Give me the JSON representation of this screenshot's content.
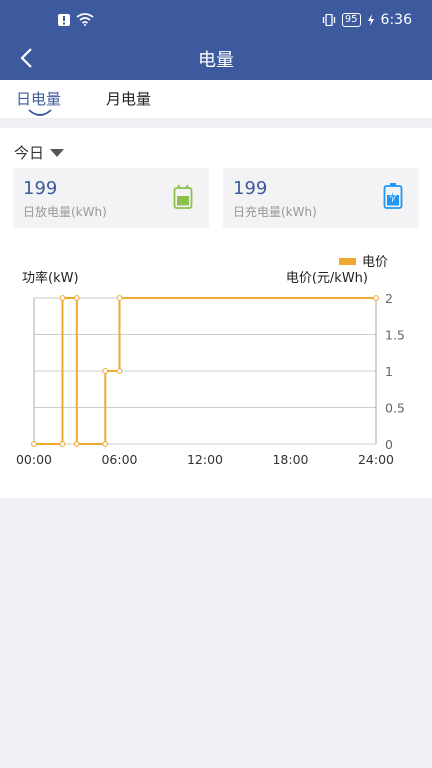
{
  "status_bar": {
    "battery": "95",
    "time": "6:36"
  },
  "nav": {
    "title": "电量"
  },
  "tabs": [
    {
      "label": "日电量",
      "active": true
    },
    {
      "label": "月电量",
      "active": false
    }
  ],
  "date_select": {
    "value": "今日"
  },
  "cards": [
    {
      "value": "199",
      "label": "日放电量(kWh)",
      "icon": "battery-discharge-icon",
      "color": "#8bc34a"
    },
    {
      "value": "199",
      "label": "日充电量(kWh)",
      "icon": "battery-charge-icon",
      "color": "#2196f3"
    }
  ],
  "colors": {
    "accent": "#3d5a9e",
    "series": "#f0a830"
  },
  "chart_data": {
    "type": "line",
    "ylabel_left": "功率(kW)",
    "ylabel_right": "电价(元/kWh)",
    "legend": "电价",
    "x_ticks": [
      "00:00",
      "06:00",
      "12:00",
      "18:00",
      "24:00"
    ],
    "y_ticks_right": [
      "0",
      "0.5",
      "1",
      "1.5",
      "2"
    ],
    "xlim": [
      0,
      24
    ],
    "ylim": [
      0,
      2
    ],
    "series": [
      {
        "name": "电价",
        "step": true,
        "points": [
          [
            0,
            0
          ],
          [
            2,
            0
          ],
          [
            2,
            2
          ],
          [
            3,
            2
          ],
          [
            3,
            0
          ],
          [
            5,
            0
          ],
          [
            5,
            1
          ],
          [
            6,
            1
          ],
          [
            6,
            2
          ],
          [
            24,
            2
          ]
        ]
      }
    ]
  }
}
